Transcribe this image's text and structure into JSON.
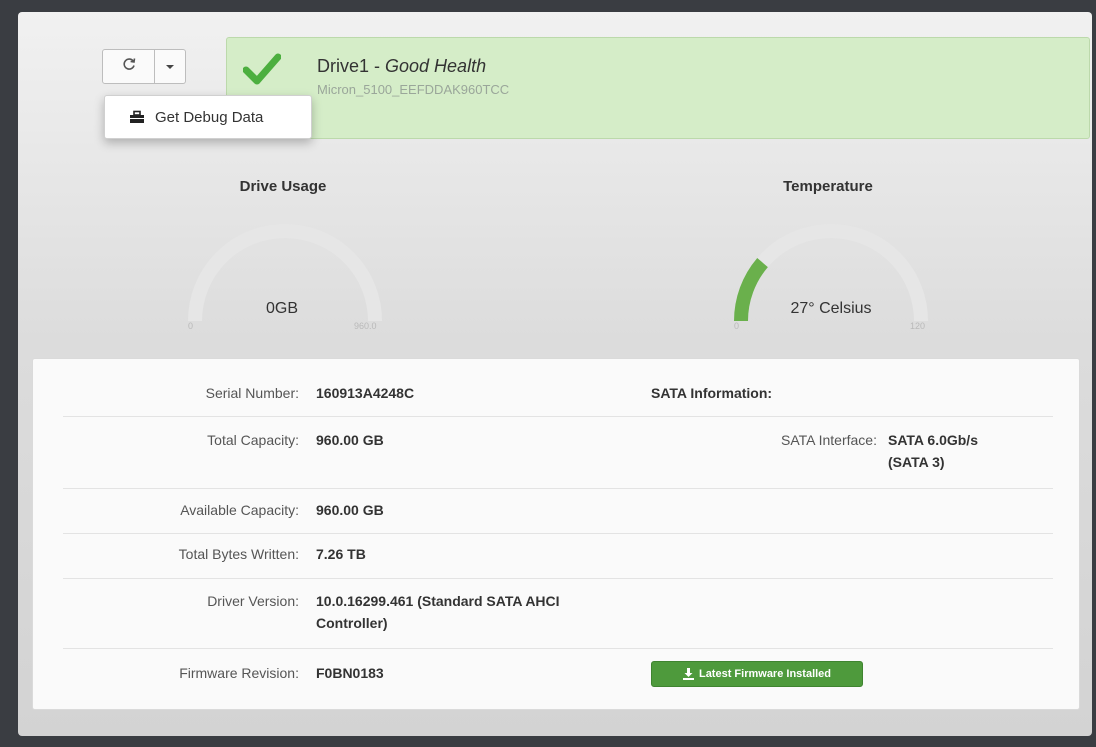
{
  "toolbar": {
    "refresh_icon": "refresh-icon",
    "dropdown_toggle_icon": "caret-down-icon",
    "dropdown_items": [
      {
        "icon": "toolbox-icon",
        "label": "Get Debug Data"
      }
    ]
  },
  "drive": {
    "name": "Drive1",
    "separator": " - ",
    "health": "Good Health",
    "model": "Micron_5100_EEFDDAK960TCC",
    "status_icon": "checkmark-icon",
    "status_color": "#5cb04a"
  },
  "gauges": {
    "usage": {
      "title": "Drive Usage",
      "value_text": "0GB",
      "min": "0",
      "max": "960.0",
      "value": 0,
      "max_value": 960
    },
    "temperature": {
      "title": "Temperature",
      "value_text": "27° Celsius",
      "min": "0",
      "max": "120",
      "value": 27,
      "max_value": 120,
      "color": "#6ab04c"
    }
  },
  "details": {
    "rows": [
      {
        "label": "Serial Number:",
        "value": "160913A4248C"
      },
      {
        "label": "Total Capacity:",
        "value": "960.00 GB"
      },
      {
        "label": "Available Capacity:",
        "value": "960.00 GB"
      },
      {
        "label": "Total Bytes Written:",
        "value": "7.26 TB"
      },
      {
        "label": "Driver Version:",
        "value_line1": "10.0.16299.461 (Standard SATA AHCI",
        "value_line2": "Controller)"
      },
      {
        "label": "Firmware Revision:",
        "value": "F0BN0183"
      }
    ],
    "sata": {
      "heading": "SATA Information:",
      "interface_label": "SATA Interface:",
      "interface_line1": "SATA 6.0Gb/s",
      "interface_line2": "(SATA 3)"
    },
    "firmware_status": {
      "icon": "download-icon",
      "label": "Latest Firmware Installed"
    }
  }
}
